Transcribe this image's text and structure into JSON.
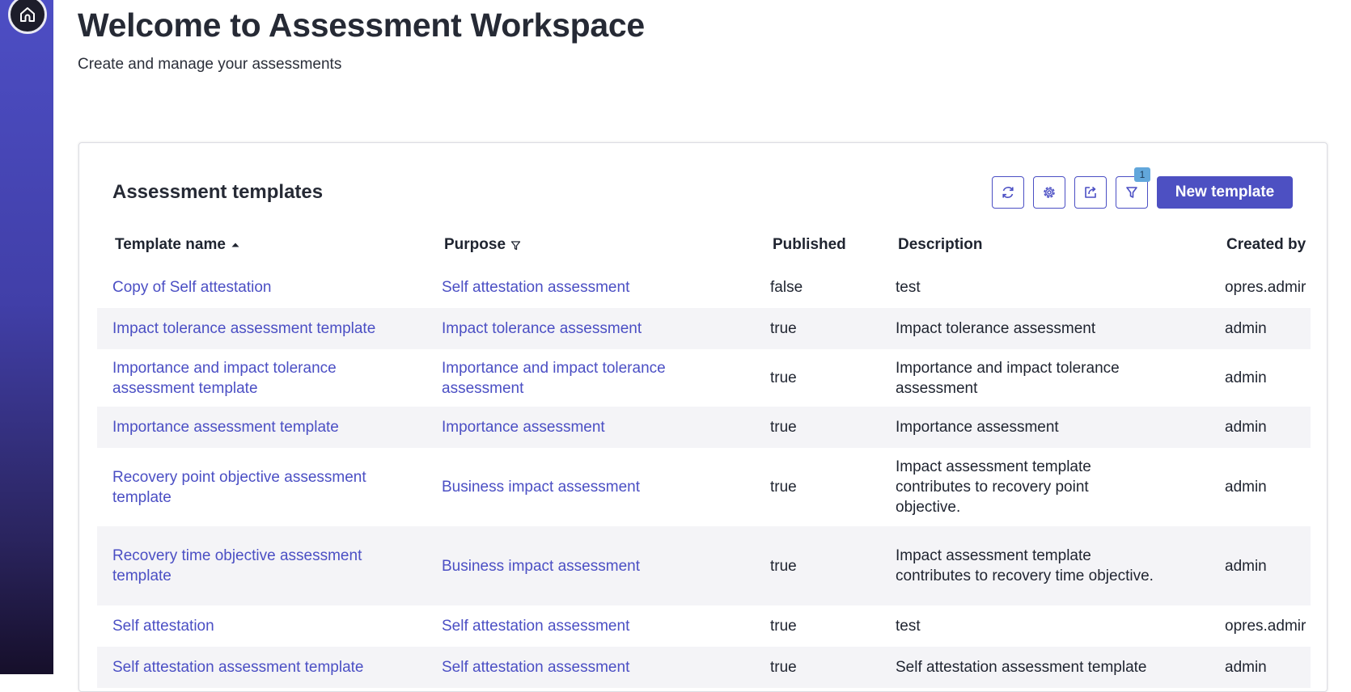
{
  "page": {
    "title": "Welcome to Assessment Workspace",
    "subtitle": "Create and manage your assessments"
  },
  "templates": {
    "title": "Assessment templates",
    "new_button": "New template",
    "filter_count": "1",
    "toolbar_icons": [
      "refresh-icon",
      "settings-icon",
      "export-icon",
      "filter-icon"
    ],
    "columns": {
      "name": "Template name",
      "purpose": "Purpose",
      "published": "Published",
      "description": "Description",
      "created_by": "Created by"
    },
    "rows": [
      {
        "name": "Copy of Self attestation",
        "purpose": "Self attestation assessment",
        "published": "false",
        "description": "test",
        "created_by": "opres.admir"
      },
      {
        "name": "Impact tolerance assessment template",
        "purpose": "Impact tolerance assessment",
        "published": "true",
        "description": "Impact tolerance assessment",
        "created_by": "admin"
      },
      {
        "name": "Importance and impact tolerance assessment template",
        "purpose": "Importance and impact tolerance assessment",
        "published": "true",
        "description": "Importance and impact tolerance assessment",
        "created_by": "admin"
      },
      {
        "name": "Importance assessment template",
        "purpose": "Importance assessment",
        "published": "true",
        "description": "Importance assessment",
        "created_by": "admin"
      },
      {
        "name": "Recovery point objective assessment template",
        "purpose": "Business impact assessment",
        "published": "true",
        "description": "Impact assessment template contributes to recovery point objective.",
        "created_by": "admin"
      },
      {
        "name": "Recovery time objective assessment template",
        "purpose": "Business impact assessment",
        "published": "true",
        "description": "Impact assessment template contributes to recovery time objective.",
        "created_by": "admin"
      },
      {
        "name": "Self attestation",
        "purpose": "Self attestation assessment",
        "published": "true",
        "description": "test",
        "created_by": "opres.admir"
      },
      {
        "name": "Self attestation assessment template",
        "purpose": "Self attestation assessment",
        "published": "true",
        "description": "Self attestation assessment template",
        "created_by": "admin"
      }
    ]
  },
  "colors": {
    "accent": "#4d50c2",
    "link": "#4b4fc4",
    "row_alt": "#f4f4f7",
    "badge": "#62a7db"
  }
}
